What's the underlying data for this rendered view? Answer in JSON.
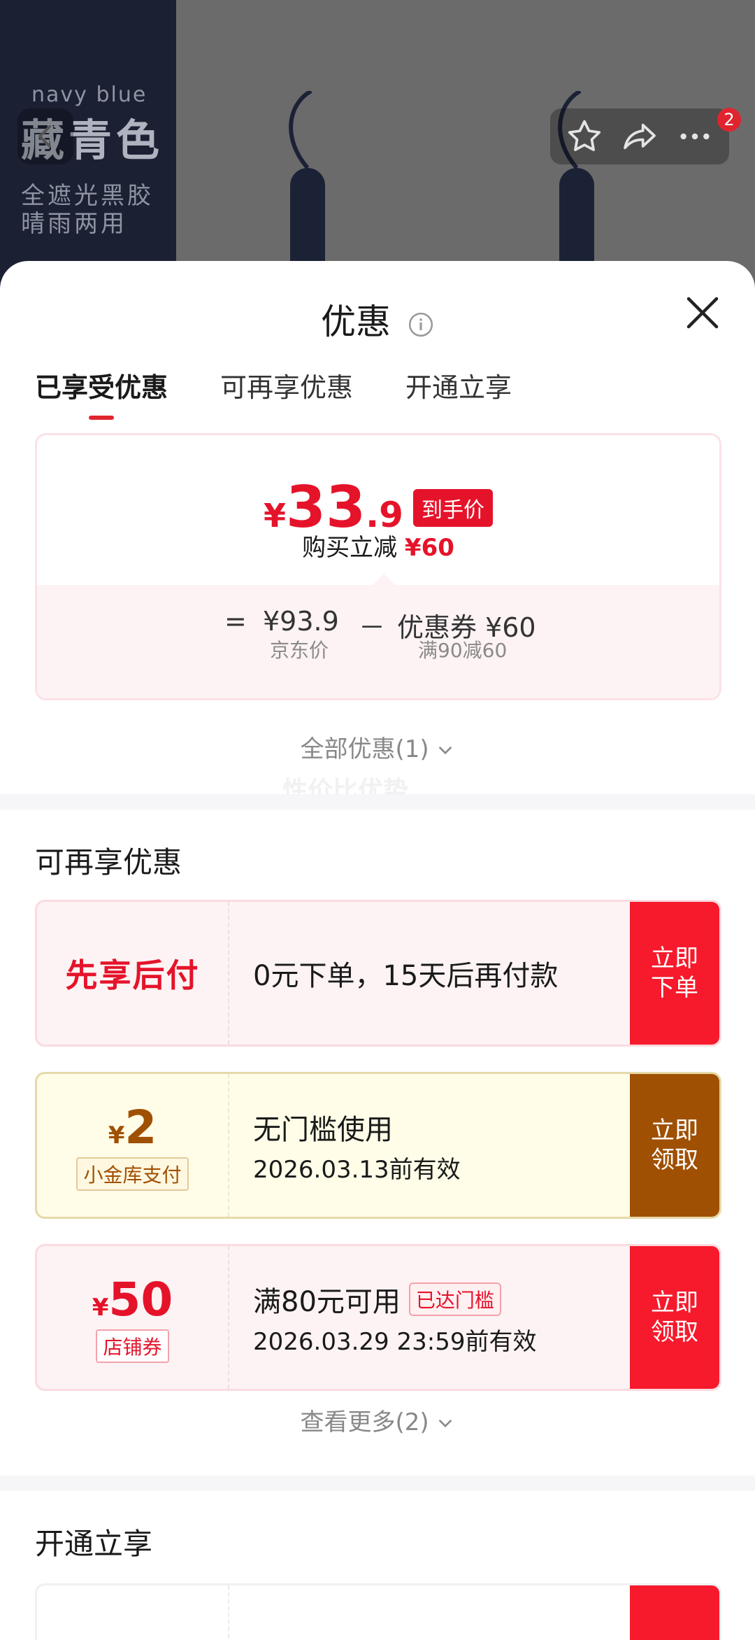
{
  "background": {
    "color_name_en": "navy blue",
    "color_name_cn": "藏青色",
    "feature1": "全遮光黑胶",
    "feature2": "晴雨两用",
    "cart_badge": "2"
  },
  "sheet": {
    "title": "优惠"
  },
  "tabs": [
    {
      "label": "已享受优惠",
      "active": true
    },
    {
      "label": "可再享优惠",
      "active": false
    },
    {
      "label": "开通立享",
      "active": false
    }
  ],
  "price_card": {
    "yen": "¥",
    "price_int": "33",
    "price_dec": ".9",
    "price_tag": "到手价",
    "saving_label": "购买立减",
    "saving_value": "¥60",
    "formula": {
      "equals": "=",
      "jd_price": "¥93.9",
      "minus": "－",
      "coupon": "优惠券 ¥60",
      "jd_price_label": "京东价",
      "coupon_label": "满90减60"
    }
  },
  "all_offers": "全部优惠(1)",
  "watermark": "性价比优势",
  "section_more": {
    "title": "可再享优惠",
    "coupons": [
      {
        "left_title": "先享后付",
        "main": "0元下单，15天后再付款",
        "btn1": "立即",
        "btn2": "下单"
      },
      {
        "yen": "¥",
        "amount": "2",
        "tag": "小金库支付",
        "main": "无门槛使用",
        "sub": "2026.03.13前有效",
        "btn1": "立即",
        "btn2": "领取"
      },
      {
        "yen": "¥",
        "amount": "50",
        "tag": "店铺券",
        "main": "满80元可用",
        "badge": "已达门槛",
        "sub": "2026.03.29 23:59前有效",
        "btn1": "立即",
        "btn2": "领取"
      }
    ],
    "more_link": "查看更多(2)"
  },
  "section_open": {
    "title": "开通立享"
  },
  "colors": {
    "accent_red": "#e5132a",
    "button_red": "#f61a2c",
    "button_brown": "#a05003"
  }
}
